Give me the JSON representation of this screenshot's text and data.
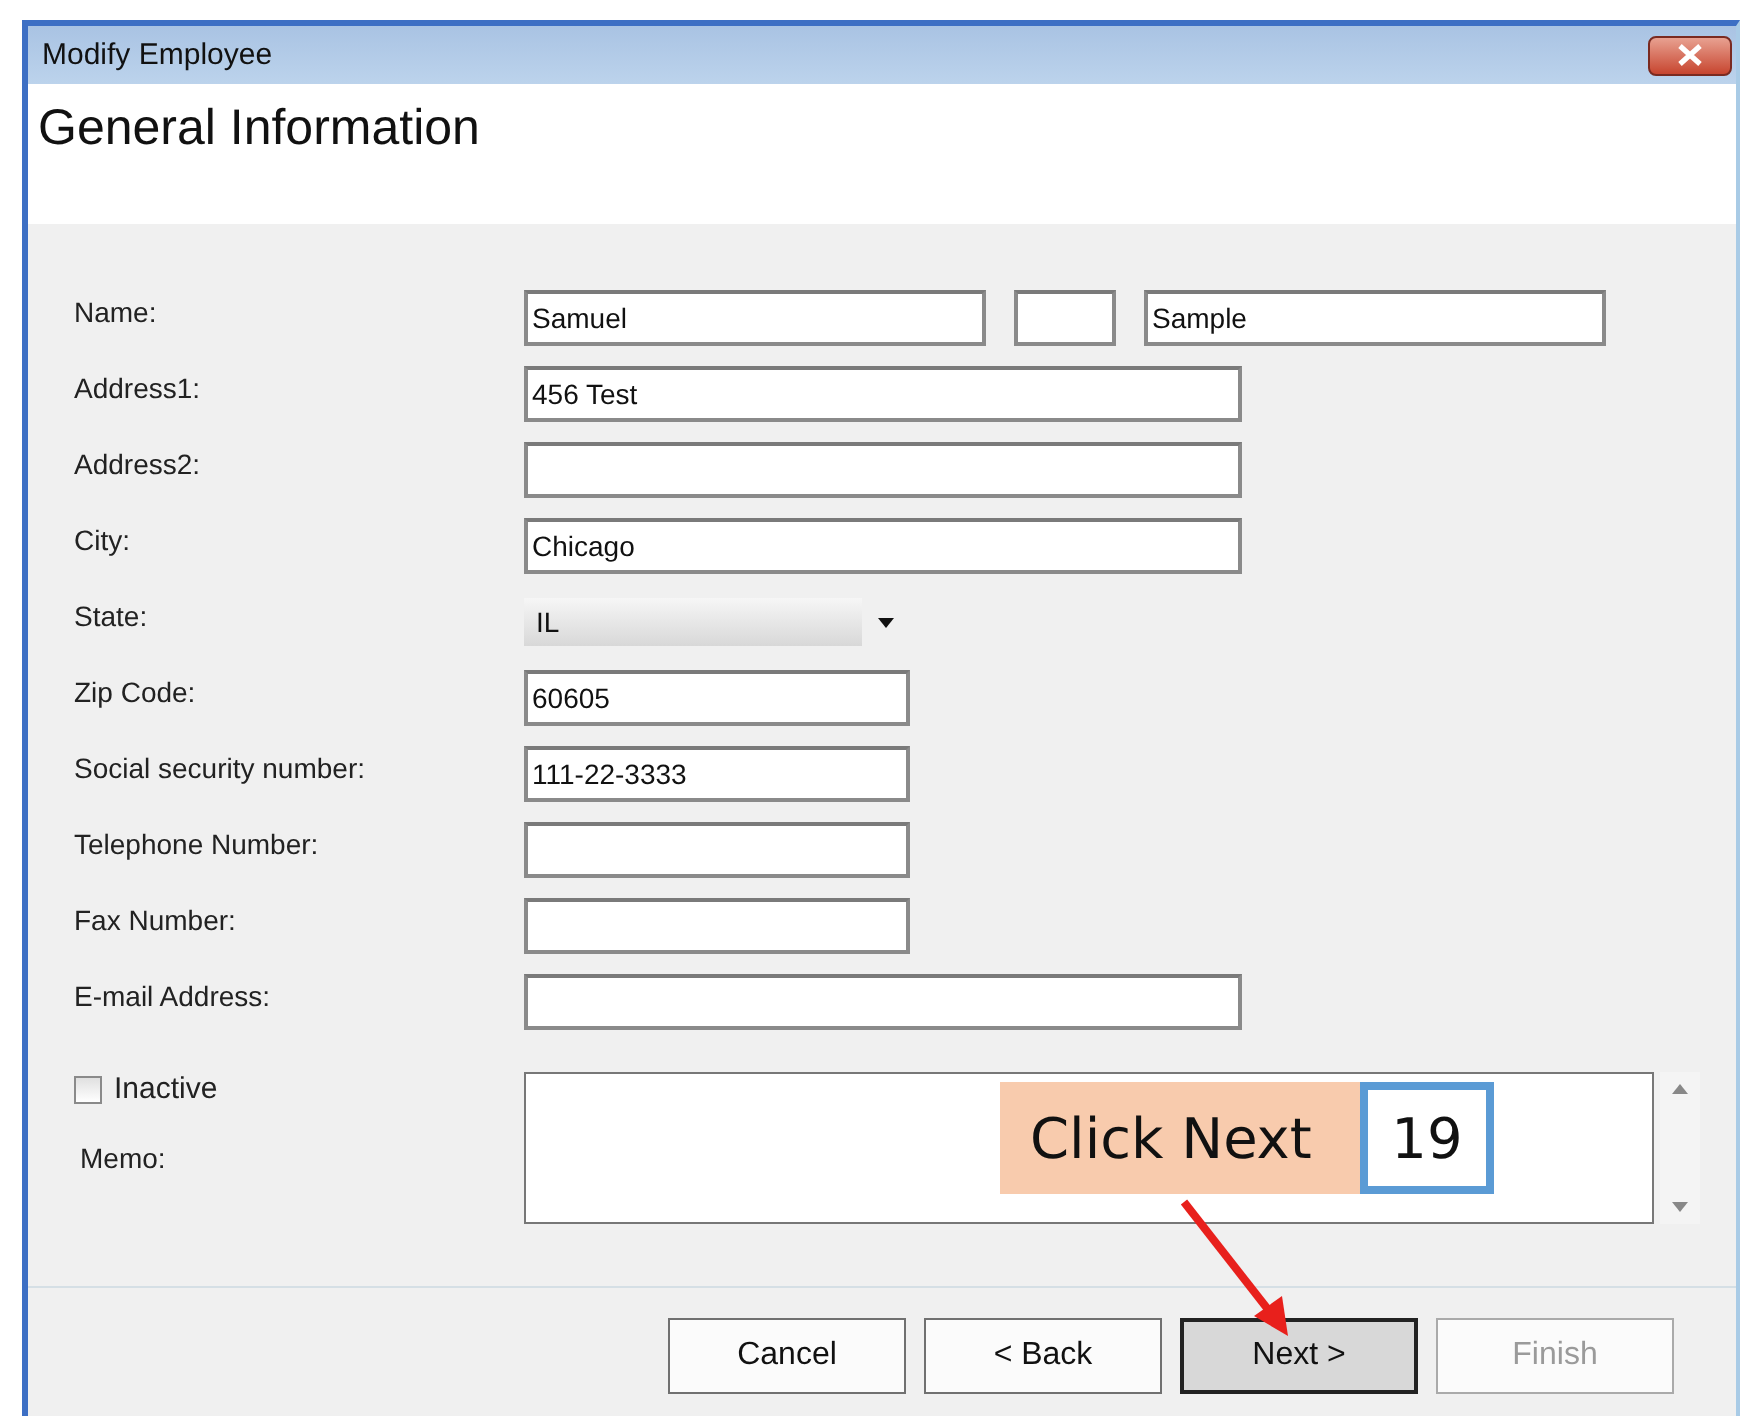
{
  "window": {
    "title": "Modify Employee"
  },
  "header": {
    "title": "General Information"
  },
  "fields": [
    {
      "label": "Name:",
      "kind": "name",
      "first": "Samuel",
      "last": "Sample"
    },
    {
      "label": "Address1:",
      "kind": "wide",
      "value": "456 Test"
    },
    {
      "label": "Address2:",
      "kind": "wide"
    },
    {
      "label": "City:",
      "kind": "wide",
      "value": "Chicago"
    },
    {
      "label": "State:",
      "kind": "select",
      "value": "IL"
    },
    {
      "label": "Zip Code:",
      "kind": "short",
      "value": "60605"
    },
    {
      "label": "Social security number:",
      "kind": "short",
      "value": "111-22-3333"
    },
    {
      "label": "Telephone Number:",
      "kind": "short"
    },
    {
      "label": "Fax Number:",
      "kind": "short"
    },
    {
      "label": "E-mail Address:",
      "kind": "wide"
    }
  ],
  "inactive": {
    "label": "Inactive",
    "checked": false
  },
  "memo": {
    "label": "Memo:"
  },
  "buttons": [
    {
      "label": "Cancel",
      "default": false,
      "disabled": false
    },
    {
      "label": "< Back",
      "default": false,
      "disabled": false
    },
    {
      "label": "Next >",
      "default": true,
      "disabled": false
    },
    {
      "label": "Finish",
      "default": false,
      "disabled": true
    }
  ],
  "annotation": {
    "text": "Click Next",
    "step": "19"
  }
}
